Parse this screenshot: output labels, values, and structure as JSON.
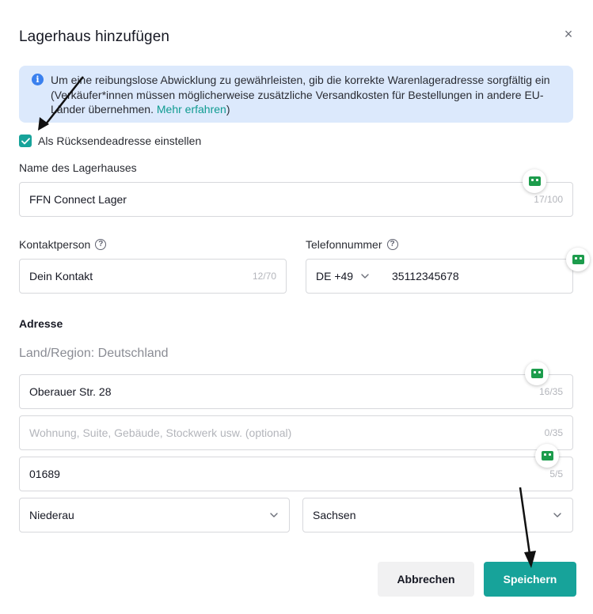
{
  "dialog": {
    "title": "Lagerhaus hinzufügen",
    "close_glyph": "×"
  },
  "info": {
    "text": "Um eine reibungslose Abwicklung zu gewährleisten, gib die korrekte Warenlageradresse sorgfältig ein (Verkäufer*innen müssen möglicherweise zusätzliche Versandkosten für Bestellungen in andere EU-Länder übernehmen. ",
    "link": "Mehr erfahren",
    "closing": ")"
  },
  "return_address": {
    "label": "Als Rücksendeadresse einstellen",
    "checked": true
  },
  "warehouse_name": {
    "label": "Name des Lagerhauses",
    "value": "FFN Connect Lager",
    "counter": "17/100"
  },
  "contact": {
    "label": "Kontaktperson",
    "value": "Dein Kontakt",
    "counter": "12/70"
  },
  "phone": {
    "label": "Telefonnummer",
    "country_code": "DE +49",
    "value": "35112345678"
  },
  "address": {
    "section_label": "Adresse",
    "region_label": "Land/Region: Deutschland",
    "street": {
      "value": "Oberauer Str. 28",
      "counter": "16/35"
    },
    "line2": {
      "placeholder": "Wohnung, Suite, Gebäude, Stockwerk usw. (optional)",
      "counter": "0/35"
    },
    "postal_code": {
      "value": "01689",
      "counter": "5/5"
    },
    "city": "Niederau",
    "state": "Sachsen"
  },
  "footer": {
    "cancel_label": "Abbrechen",
    "save_label": "Speichern"
  },
  "icons": {
    "info": "info-icon",
    "help": "help-circle-icon",
    "dropdown": "chevron-down-icon",
    "extension": "autofill-extension-icon",
    "annotation": "arrow-annotation"
  },
  "colors": {
    "accent": "#17a39a",
    "banner_bg": "#dce9fc",
    "info_icon": "#3a80ee",
    "extension_icon": "#1c9c4c"
  }
}
